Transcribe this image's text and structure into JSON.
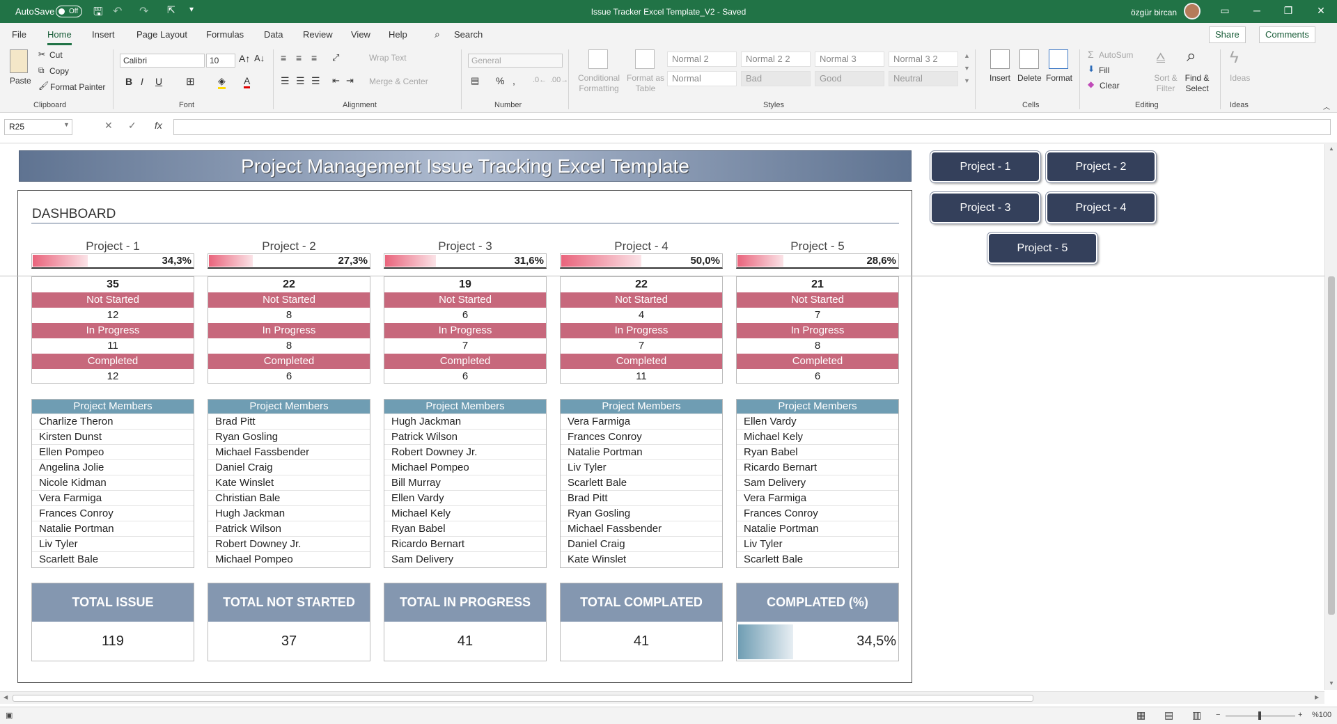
{
  "titlebar": {
    "autosave_label": "AutoSave",
    "autosave_state": "Off",
    "file_title": "Issue Tracker Excel Template_V2  -  Saved",
    "user_name": "özgür bircan"
  },
  "menu": {
    "tabs": [
      "File",
      "Home",
      "Insert",
      "Page Layout",
      "Formulas",
      "Data",
      "Review",
      "View",
      "Help"
    ],
    "search": "Search",
    "share": "Share",
    "comments": "Comments"
  },
  "ribbon": {
    "clipboard": {
      "paste": "Paste",
      "cut": "Cut",
      "copy": "Copy",
      "format_painter": "Format Painter",
      "label": "Clipboard"
    },
    "font": {
      "name": "Calibri",
      "size": "10",
      "label": "Font"
    },
    "alignment": {
      "wrap": "Wrap Text",
      "merge": "Merge & Center",
      "label": "Alignment"
    },
    "number": {
      "format": "General",
      "label": "Number"
    },
    "styles": {
      "conditional": "Conditional Formatting",
      "format_table": "Format as Table",
      "cells": [
        "Normal 2",
        "Normal 2 2",
        "Normal 3",
        "Normal 3 2",
        "Normal",
        "Bad",
        "Good",
        "Neutral"
      ],
      "label": "Styles"
    },
    "cells": {
      "insert": "Insert",
      "delete": "Delete",
      "format": "Format",
      "label": "Cells"
    },
    "editing": {
      "autosum": "AutoSum",
      "fill": "Fill",
      "clear": "Clear",
      "sort": "Sort & Filter",
      "find": "Find & Select",
      "label": "Editing"
    },
    "ideas": {
      "ideas": "Ideas",
      "label": "Ideas"
    }
  },
  "formula_bar": {
    "name_box": "R25",
    "fx": "fx",
    "value": ""
  },
  "sheet": {
    "banner": "Project Management Issue Tracking Excel Template",
    "dashboard_title": "DASHBOARD",
    "labels": {
      "not_started": "Not Started",
      "in_progress": "In Progress",
      "completed": "Completed",
      "members": "Project Members"
    },
    "projects": [
      {
        "name": "Project - 1",
        "pct_label": "34,3%",
        "pct": 0.343,
        "total": "35",
        "not_started": "12",
        "in_progress": "11",
        "completed": "12",
        "members": [
          "Charlize Theron",
          "Kirsten Dunst",
          "Ellen Pompeo",
          "Angelina Jolie",
          "Nicole Kidman",
          "Vera Farmiga",
          "Frances Conroy",
          "Natalie Portman",
          "Liv Tyler",
          "Scarlett Bale"
        ]
      },
      {
        "name": "Project - 2",
        "pct_label": "27,3%",
        "pct": 0.273,
        "total": "22",
        "not_started": "8",
        "in_progress": "8",
        "completed": "6",
        "members": [
          "Brad Pitt",
          "Ryan Gosling",
          "Michael Fassbender",
          "Daniel Craig",
          "Kate Winslet",
          "Christian Bale",
          "Hugh Jackman",
          "Patrick Wilson",
          "Robert Downey Jr.",
          "Michael Pompeo"
        ]
      },
      {
        "name": "Project - 3",
        "pct_label": "31,6%",
        "pct": 0.316,
        "total": "19",
        "not_started": "6",
        "in_progress": "7",
        "completed": "6",
        "members": [
          "Hugh Jackman",
          "Patrick Wilson",
          "Robert Downey Jr.",
          "Michael Pompeo",
          "Bill Murray",
          "Ellen Vardy",
          "Michael Kely",
          "Ryan Babel",
          "Ricardo Bernart",
          "Sam Delivery"
        ]
      },
      {
        "name": "Project - 4",
        "pct_label": "50,0%",
        "pct": 0.5,
        "total": "22",
        "not_started": "4",
        "in_progress": "7",
        "completed": "11",
        "members": [
          "Vera Farmiga",
          "Frances Conroy",
          "Natalie Portman",
          "Liv Tyler",
          "Scarlett Bale",
          "Brad Pitt",
          "Ryan Gosling",
          "Michael Fassbender",
          "Daniel Craig",
          "Kate Winslet"
        ]
      },
      {
        "name": "Project - 5",
        "pct_label": "28,6%",
        "pct": 0.286,
        "total": "21",
        "not_started": "7",
        "in_progress": "8",
        "completed": "6",
        "members": [
          "Ellen Vardy",
          "Michael Kely",
          "Ryan Babel",
          "Ricardo Bernart",
          "Sam Delivery",
          "Vera Farmiga",
          "Frances Conroy",
          "Natalie Portman",
          "Liv Tyler",
          "Scarlett Bale"
        ]
      }
    ],
    "kpis": [
      {
        "label": "TOTAL ISSUE",
        "value": "119"
      },
      {
        "label": "TOTAL NOT STARTED",
        "value": "37"
      },
      {
        "label": "TOTAL IN PROGRESS",
        "value": "41"
      },
      {
        "label": "TOTAL COMPLATED",
        "value": "41"
      },
      {
        "label": "COMPLATED (%)",
        "value": "34,5%",
        "pct": 0.345
      }
    ],
    "nav_buttons": [
      "Project - 1",
      "Project - 2",
      "Project - 3",
      "Project - 4",
      "Project - 5"
    ]
  },
  "statusbar": {
    "zoom": "%100"
  },
  "colors": {
    "excel_green": "#217346",
    "stat_header": "#c7687c",
    "member_header": "#6f9db3",
    "kpi_header": "#8497b0",
    "nav_button": "#34405b"
  }
}
